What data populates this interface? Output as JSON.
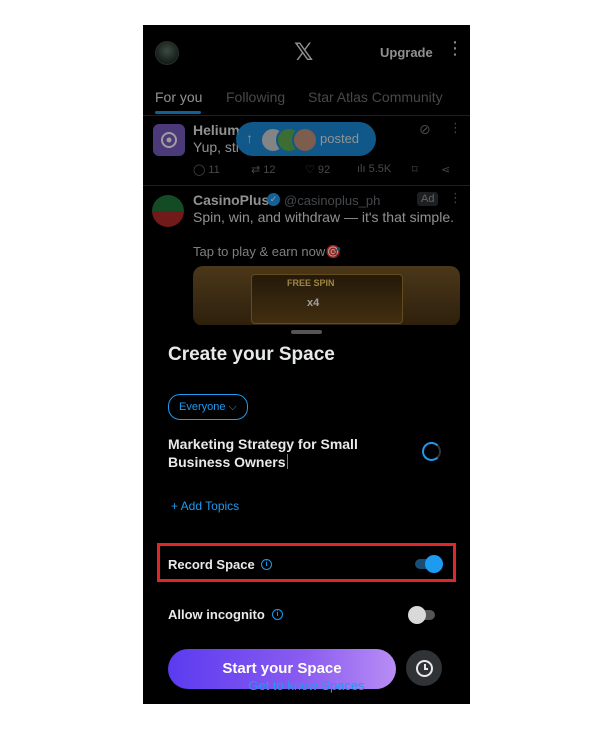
{
  "header": {
    "logo_glyph": "𝕏",
    "upgrade_label": "Upgrade",
    "more_glyph": "⋮"
  },
  "tabs": [
    {
      "label": "For you",
      "active": true
    },
    {
      "label": "Following",
      "active": false
    },
    {
      "label": "Star Atlas Community",
      "active": false
    }
  ],
  "feed": {
    "posted_pill": {
      "arrow": "↑",
      "label": "posted"
    },
    "tweet1": {
      "name": "Helium",
      "text": "Yup, sti",
      "metrics": {
        "replies": "11",
        "reposts": "12",
        "likes": "92",
        "views": "5.5K"
      }
    },
    "tweet2": {
      "name": "CasinoPlus",
      "handle": "@casinoplus_ph",
      "ad_label": "Ad",
      "text": "Spin, win, and withdraw — it's that simple.",
      "cta": "Tap to play & earn now🎯",
      "promo_free_spin": "FREE SPIN",
      "promo_multiplier": "x4"
    }
  },
  "sheet": {
    "title": "Create your Space",
    "audience": "Everyone ⌵",
    "space_title_line1": "Marketing Strategy for Small",
    "space_title_line2": "Business Owners",
    "add_topics": "+ Add Topics",
    "record_space_label": "Record Space",
    "record_space_on": true,
    "allow_incognito_label": "Allow incognito",
    "allow_incognito_on": false,
    "start_button": "Start your Space",
    "know_link": "Get to know Spaces"
  },
  "colors": {
    "accent": "#1d9bf0",
    "highlight_box": "#e0252b",
    "start_gradient_left": "#5b3bf0",
    "start_gradient_right": "#b88df5"
  }
}
